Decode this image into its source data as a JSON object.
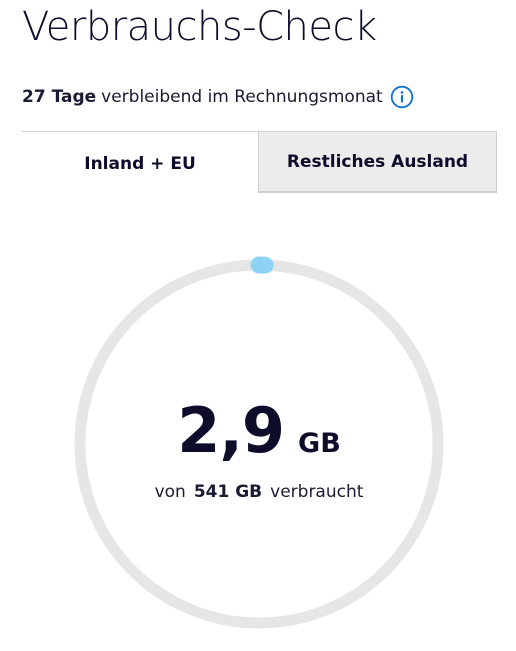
{
  "header": {
    "title": "Verbrauchs-Check"
  },
  "billing": {
    "days_remaining": "27 Tage",
    "days_text": "verbleibend im Rechnungsmonat"
  },
  "tabs": [
    {
      "label": "Inland + EU",
      "active": true
    },
    {
      "label": "Restliches Ausland",
      "active": false
    }
  ],
  "usage": {
    "used_value": "2,9",
    "used_unit": "GB",
    "prefix": "von",
    "total": "541 GB",
    "suffix": "verbraucht",
    "fraction_used": 0.0054
  },
  "colors": {
    "ring_track": "#e6e6e6",
    "ring_progress": "#8fd3f4",
    "info_icon": "#0d6fd1",
    "tab_inactive_bg": "#ececec",
    "text_dark": "#0d0d2b"
  },
  "icons": {
    "info": "info-circle-icon"
  }
}
